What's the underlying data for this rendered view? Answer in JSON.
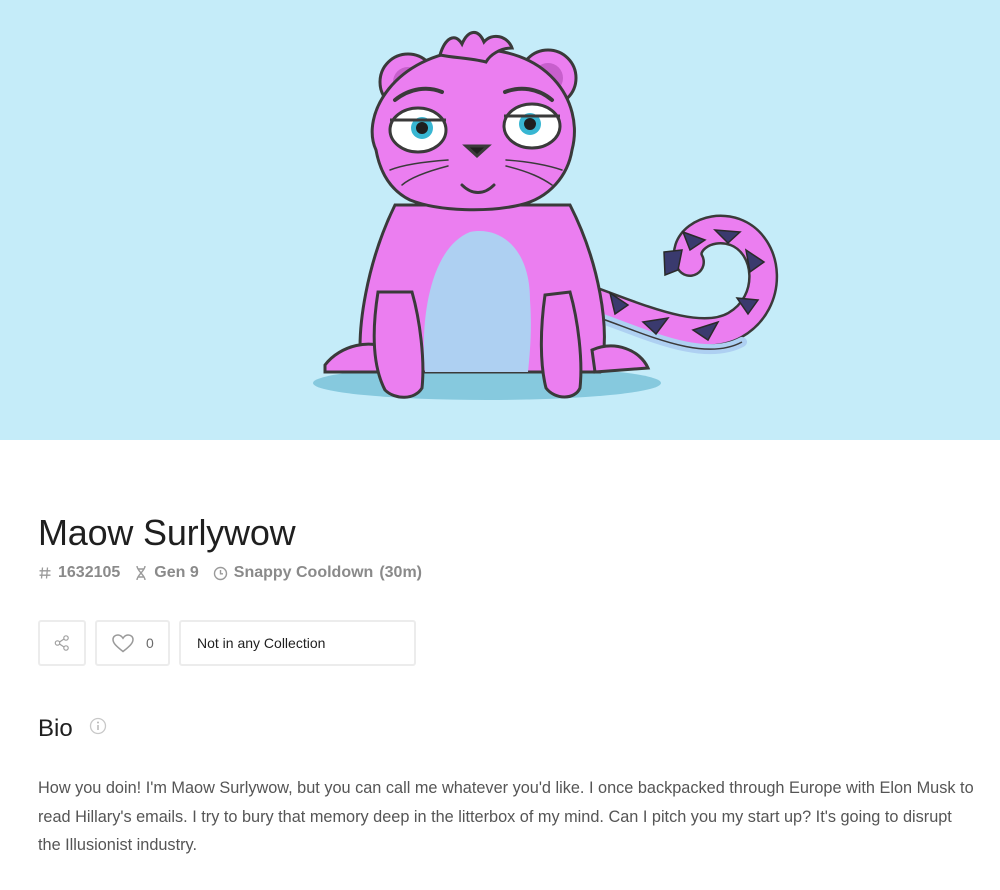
{
  "colors": {
    "hero_background": "#c5ecf9",
    "cat_body": "#eb7ef0",
    "cat_belly": "#aed0f2",
    "accent_dark": "#3a3a6e",
    "text_primary": "#1f1f1f",
    "text_muted": "#8a8a8a"
  },
  "kitty": {
    "name": "Maow Surlywow",
    "id": "1632105",
    "generation": "Gen 9",
    "cooldown_name": "Snappy Cooldown",
    "cooldown_time": "(30m)"
  },
  "icons": {
    "id": "hash-icon",
    "generation": "dna-icon",
    "cooldown": "clock-icon",
    "share": "share-icon",
    "like": "heart-icon",
    "info": "info-icon"
  },
  "actions": {
    "like_count": "0",
    "collection_label": "Not in any Collection"
  },
  "bio": {
    "heading": "Bio",
    "text": "How you doin! I'm Maow Surlywow, but you can call me whatever you'd like. I once backpacked through Europe with Elon Musk to read Hillary's emails. I try to bury that memory deep in the litterbox of my mind. Can I pitch you my start up? It's going to disrupt the Illusionist industry."
  }
}
